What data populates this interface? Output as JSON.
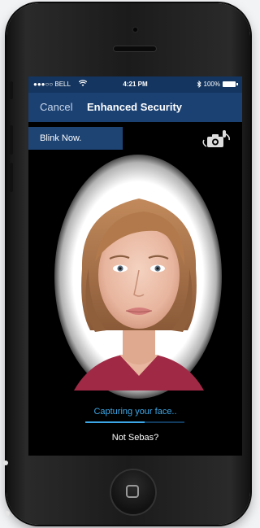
{
  "status_bar": {
    "carrier": "●●●○○ BELL",
    "time": "4:21 PM",
    "battery_text": "100%"
  },
  "nav": {
    "cancel_label": "Cancel",
    "title": "Enhanced Security"
  },
  "instruction_button": {
    "label": "Blink Now."
  },
  "capture": {
    "status_text": "Capturing your face..",
    "progress": 0.6
  },
  "not_user_link": {
    "label": "Not Sebas?"
  },
  "colors": {
    "navbar": "#1b4173",
    "statusbar": "#14355f",
    "accent": "#3da6e6"
  },
  "icons": [
    "wifi-icon",
    "bluetooth-icon",
    "battery-icon",
    "switch-camera-icon",
    "home-button-icon"
  ]
}
